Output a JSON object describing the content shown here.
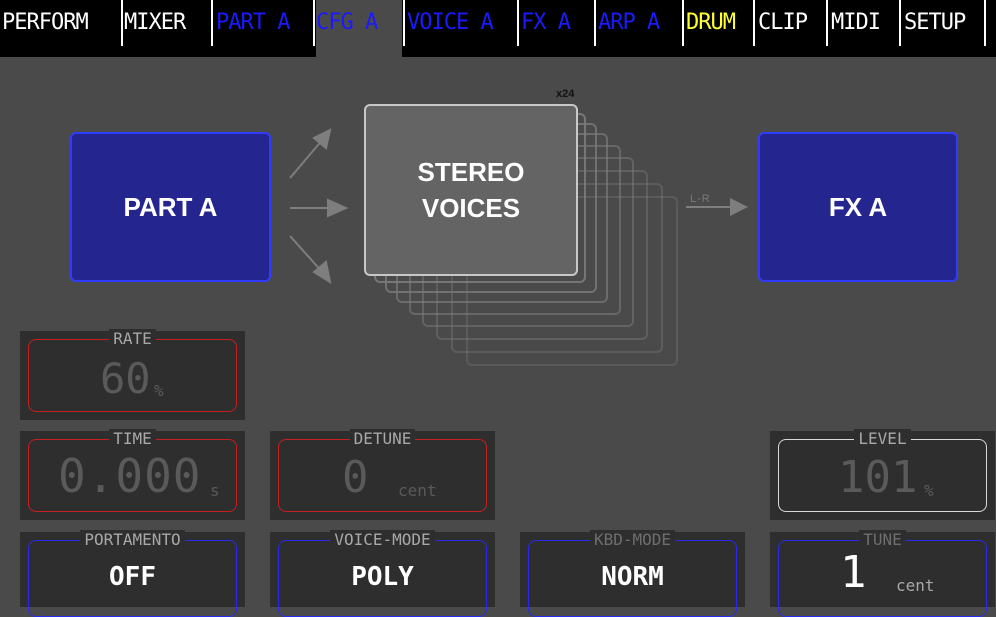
{
  "tabs": [
    {
      "label": "PERFORM",
      "color": "#ffffff"
    },
    {
      "label": "MIXER",
      "color": "#ffffff"
    },
    {
      "label": "PART A",
      "color": "#1a1aff"
    },
    {
      "label": "CFG A",
      "color": "#1a1aff",
      "active": true
    },
    {
      "label": "VOICE A",
      "color": "#1a1aff"
    },
    {
      "label": "FX A",
      "color": "#1a1aff"
    },
    {
      "label": "ARP A",
      "color": "#1a1aff"
    },
    {
      "label": "DRUM",
      "color": "#ffff30"
    },
    {
      "label": "CLIP",
      "color": "#ffffff"
    },
    {
      "label": "MIDI",
      "color": "#ffffff"
    },
    {
      "label": "SETUP",
      "color": "#ffffff"
    }
  ],
  "diagram": {
    "part_label": "PART A",
    "voices_line1": "STEREO",
    "voices_line2": "VOICES",
    "voice_count": "x24",
    "route_label": "L-R",
    "fx_label": "FX A"
  },
  "params": {
    "rate": {
      "label": "RATE",
      "value": "60",
      "unit": "%"
    },
    "time": {
      "label": "TIME",
      "value": "0.000",
      "unit": "s"
    },
    "detune": {
      "label": "DETUNE",
      "value": "0",
      "unit": "cent"
    },
    "level": {
      "label": "LEVEL",
      "value": "101",
      "unit": "%"
    },
    "portamento": {
      "label": "PORTAMENTO",
      "value": "OFF"
    },
    "voice_mode": {
      "label": "VOICE-MODE",
      "value": "POLY"
    },
    "kbd_mode": {
      "label": "KBD-MODE",
      "value": "NORM"
    },
    "tune": {
      "label": "TUNE",
      "value": "1",
      "unit": "cent"
    }
  },
  "colors": {
    "background": "#4a4a4a",
    "accent_blue": "#2f3cff",
    "inactive_red": "#c51f1f"
  }
}
